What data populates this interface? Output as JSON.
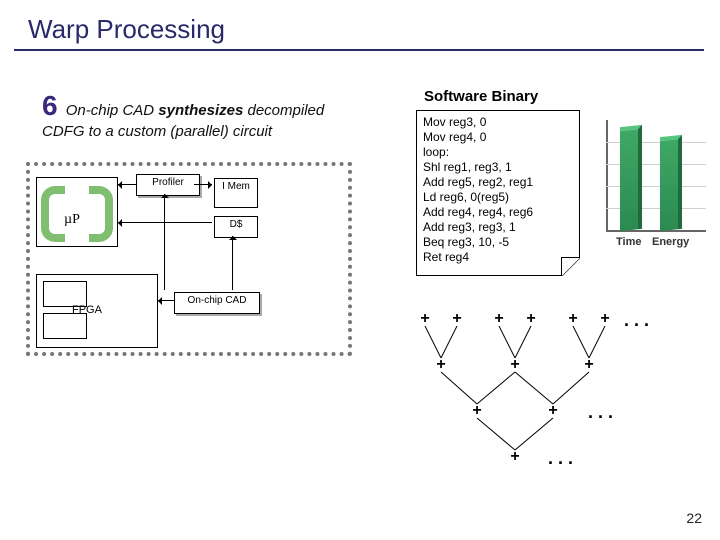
{
  "title": "Warp Processing",
  "step": {
    "num": "6",
    "text_pre": "On-chip CAD ",
    "bold": "synthesizes",
    "text_post": " decompiled CDFG to a custom (parallel) circuit"
  },
  "diagram": {
    "profiler": "Profiler",
    "imem": "I Mem",
    "ddollar": "D$",
    "oncad": "On-chip CAD",
    "mu": "µP",
    "fpga": "FPGA"
  },
  "software_binary": {
    "title": "Software Binary",
    "lines": [
      "Mov reg3, 0",
      "Mov reg4, 0",
      "loop:",
      "Shl reg1, reg3, 1",
      "Add reg5, reg2, reg1",
      "Ld reg6, 0(reg5)",
      "Add reg4, reg4, reg6",
      "Add reg3, reg3, 1",
      "Beq reg3, 10, -5",
      "Ret reg4"
    ]
  },
  "chart_data": {
    "type": "bar",
    "categories": [
      "Time",
      "Energy"
    ],
    "values": [
      95,
      85
    ],
    "ylim": [
      0,
      100
    ]
  },
  "tree": {
    "op": "+",
    "ellipsis": ". . ."
  },
  "page_number": "22"
}
